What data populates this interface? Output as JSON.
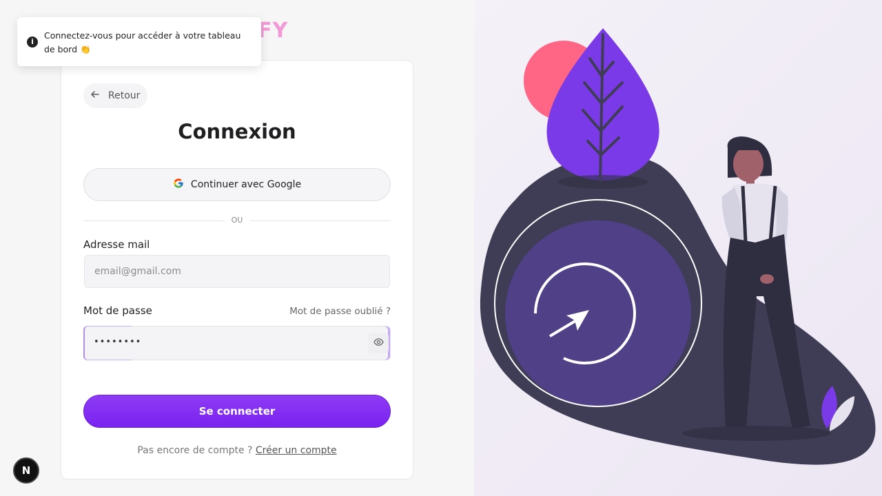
{
  "logo": {
    "visible_text": "IFY"
  },
  "toast": {
    "message": "Connectez-vous pour accéder à votre tableau de bord 👏",
    "icon": "info-icon"
  },
  "login": {
    "back_label": "Retour",
    "title": "Connexion",
    "google_label": "Continuer avec Google",
    "divider_text": "OU",
    "email_label": "Adresse mail",
    "email_placeholder": "email@gmail.com",
    "password_label": "Mot de passe",
    "forgot_label": "Mot de passe oublié ?",
    "password_mask": "••••••••",
    "submit_label": "Se connecter",
    "signup_prompt": "Pas encore de compte ?",
    "signup_link": "Créer un compte"
  },
  "dev_badge": {
    "label": "N"
  },
  "colors": {
    "accent": "#7a22f0",
    "logo_pink": "#f19ad7",
    "illustration_purple": "#7b3ae8",
    "illustration_dark": "#3f3d56",
    "illustration_red": "#ff6584"
  }
}
